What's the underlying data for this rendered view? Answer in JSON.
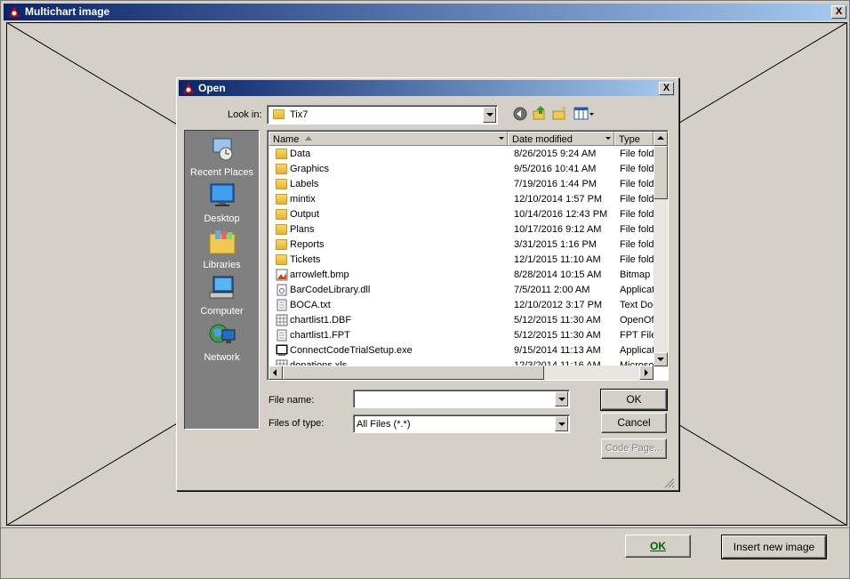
{
  "window": {
    "title": "Multichart image",
    "close": "X"
  },
  "buttons": {
    "ok": "OK",
    "insert": "Insert new image"
  },
  "dialog": {
    "title": "Open",
    "close": "X",
    "look_in_label": "Look in:",
    "look_in_value": "Tix7",
    "places": [
      "Recent Places",
      "Desktop",
      "Libraries",
      "Computer",
      "Network"
    ],
    "columns": {
      "name": "Name",
      "date": "Date modified",
      "type": "Type"
    },
    "files": [
      {
        "name": "Data",
        "date": "8/26/2015 9:24 AM",
        "type": "File folder",
        "icon": "folder-icon"
      },
      {
        "name": "Graphics",
        "date": "9/5/2016 10:41 AM",
        "type": "File folder",
        "icon": "folder-icon"
      },
      {
        "name": "Labels",
        "date": "7/19/2016 1:44 PM",
        "type": "File folder",
        "icon": "folder-icon"
      },
      {
        "name": "mintix",
        "date": "12/10/2014 1:57 PM",
        "type": "File folder",
        "icon": "folder-icon"
      },
      {
        "name": "Output",
        "date": "10/14/2016 12:43 PM",
        "type": "File folder",
        "icon": "folder-icon"
      },
      {
        "name": "Plans",
        "date": "10/17/2016 9:12 AM",
        "type": "File folder",
        "icon": "folder-icon"
      },
      {
        "name": "Reports",
        "date": "3/31/2015 1:16 PM",
        "type": "File folder",
        "icon": "folder-icon"
      },
      {
        "name": "Tickets",
        "date": "12/1/2015 11:10 AM",
        "type": "File folder",
        "icon": "folder-icon"
      },
      {
        "name": "arrowleft.bmp",
        "date": "8/28/2014 10:15 AM",
        "type": "Bitmap image",
        "icon": "bitmap-icon"
      },
      {
        "name": "BarCodeLibrary.dll",
        "date": "7/5/2011 2:00 AM",
        "type": "Application extension",
        "icon": "dll-icon"
      },
      {
        "name": "BOCA.txt",
        "date": "12/10/2012 3:17 PM",
        "type": "Text Document",
        "icon": "text-file-icon"
      },
      {
        "name": "chartlist1.DBF",
        "date": "5/12/2015 11:30 AM",
        "type": "OpenOffice",
        "icon": "table-file-icon"
      },
      {
        "name": "chartlist1.FPT",
        "date": "5/12/2015 11:30 AM",
        "type": "FPT File",
        "icon": "text-file-icon"
      },
      {
        "name": "ConnectCodeTrialSetup.exe",
        "date": "9/15/2014 11:13 AM",
        "type": "Application",
        "icon": "exe-icon"
      },
      {
        "name": "donations.xls",
        "date": "12/3/2014 11:16 AM",
        "type": "Microsoft",
        "icon": "table-file-icon"
      }
    ],
    "file_name_label": "File name:",
    "file_name_value": "",
    "files_of_type_label": "Files of type:",
    "files_of_type_value": "All Files (*.*)",
    "ok": "OK",
    "cancel": "Cancel",
    "code_page": "Code Page..."
  }
}
